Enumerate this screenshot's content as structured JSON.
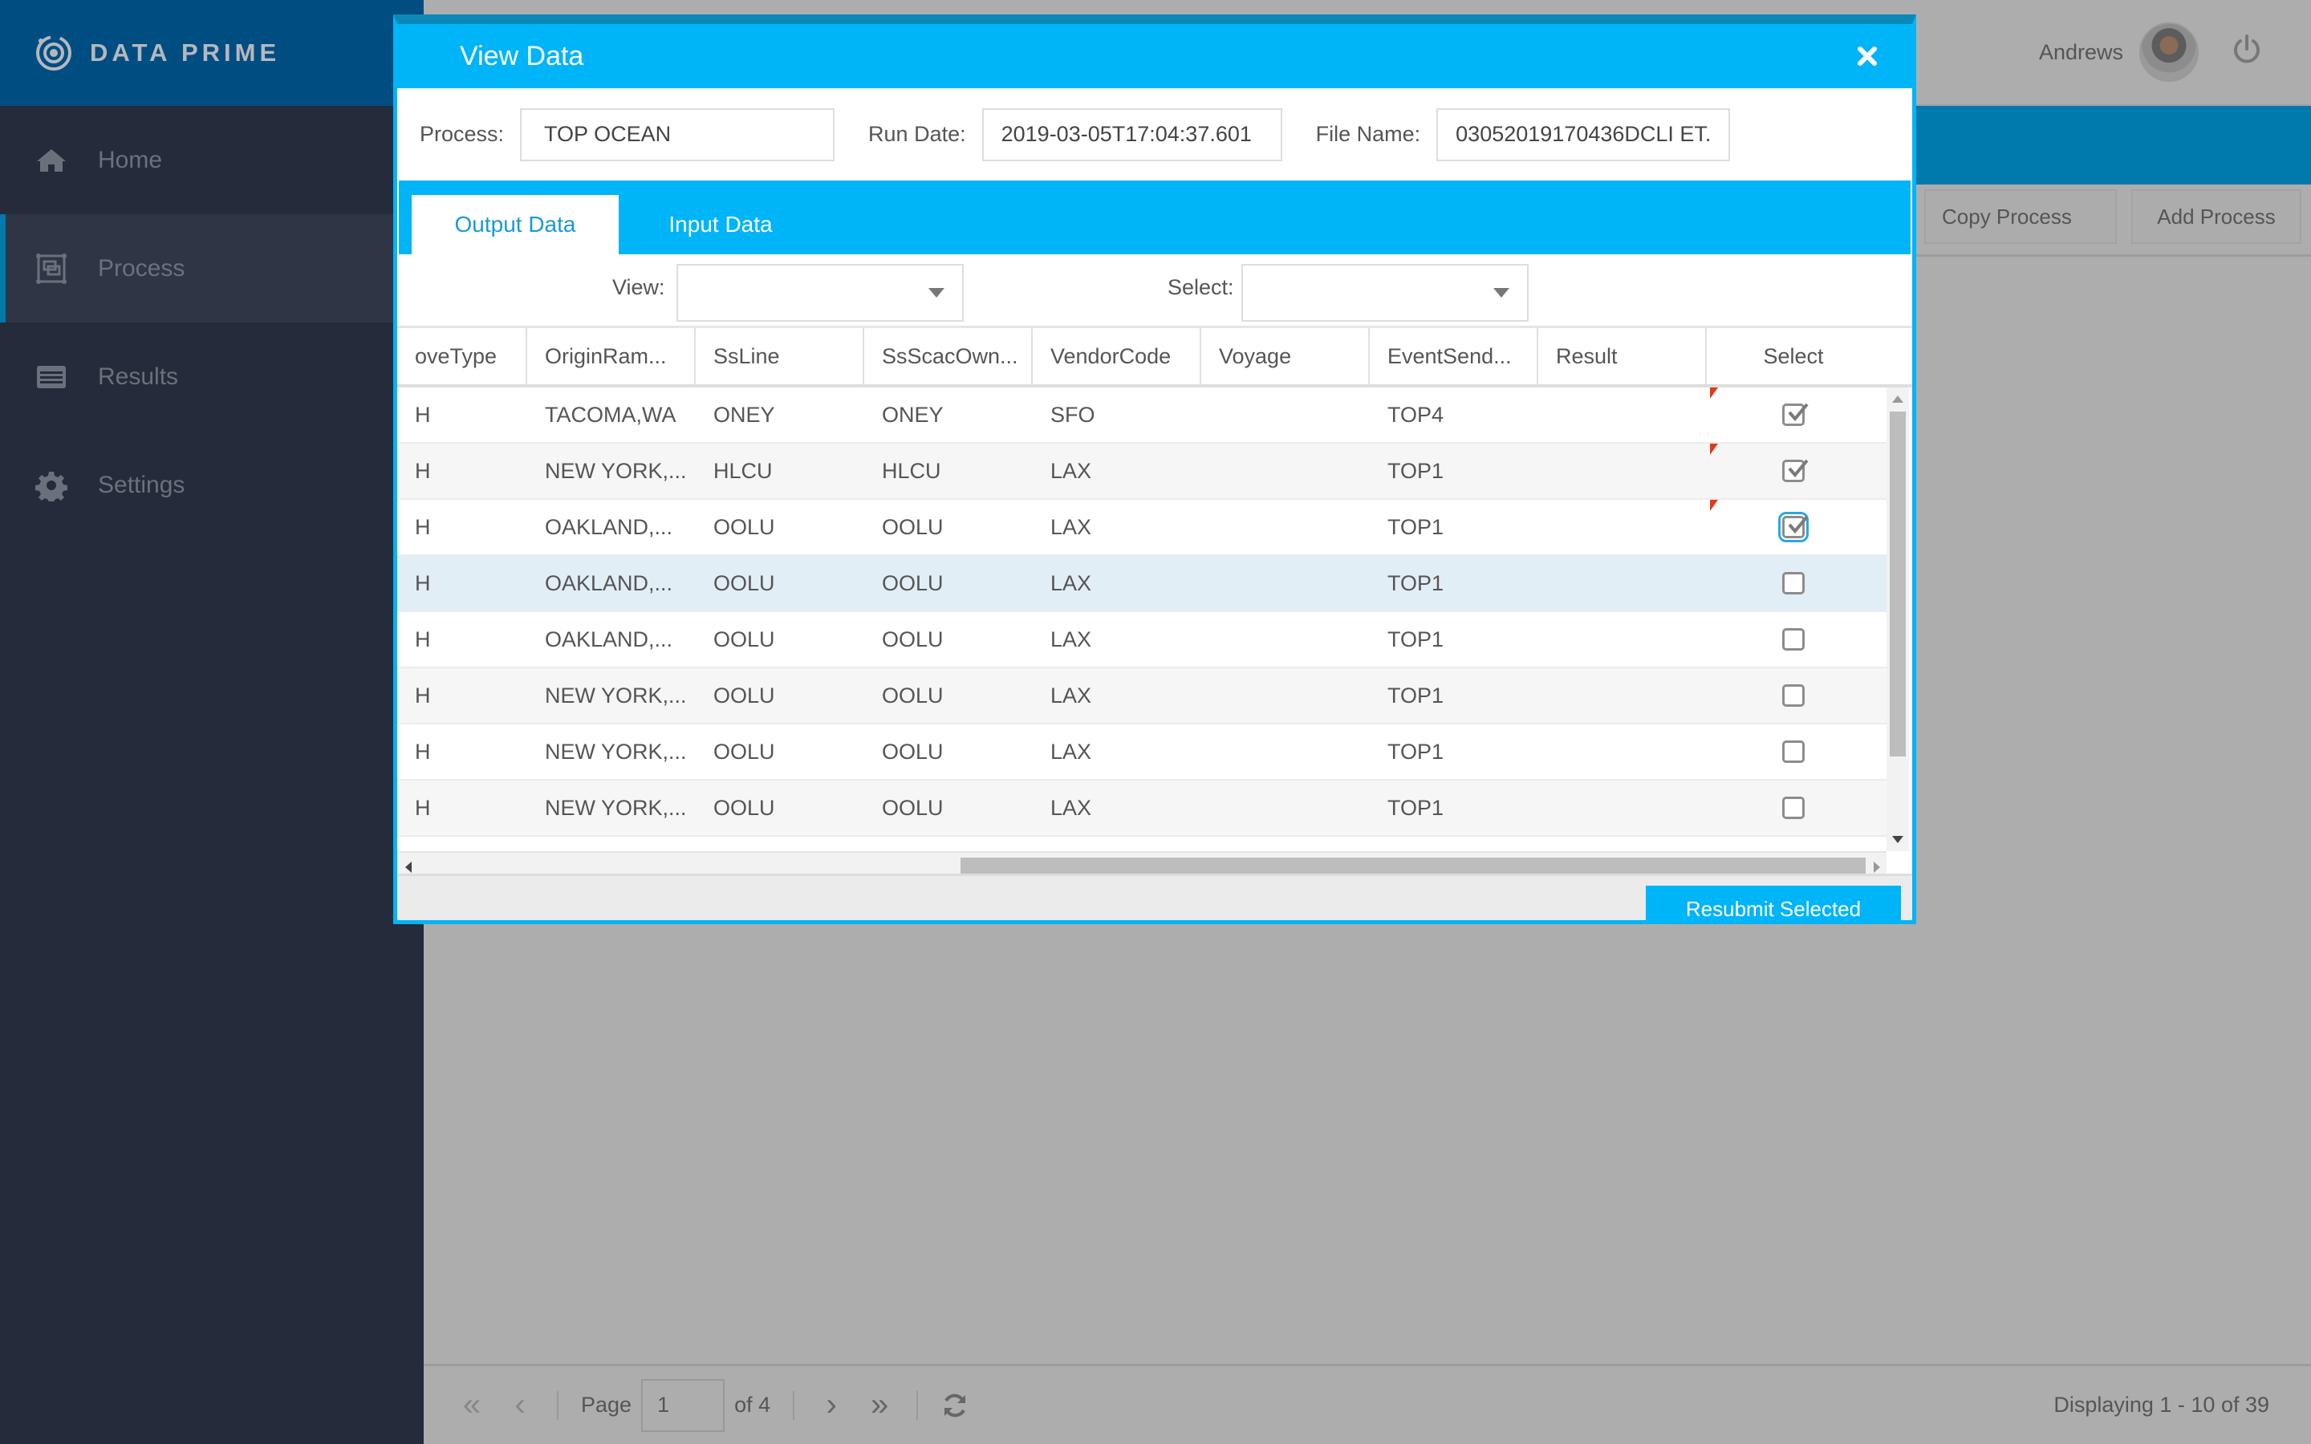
{
  "app": {
    "brand_name": "DATA PRIME",
    "user_name": "Andrews",
    "colors": {
      "accent": "#00b4f8",
      "brand_header": "#004d82",
      "sidebar_bg": "#242b3a",
      "band": "#0079ac",
      "flag": "#e03a1a"
    }
  },
  "sidebar": {
    "items": [
      {
        "label": "Home",
        "icon": "home-icon",
        "active": false
      },
      {
        "label": "Process",
        "icon": "process-icon",
        "active": true
      },
      {
        "label": "Results",
        "icon": "list-icon",
        "active": false
      },
      {
        "label": "Settings",
        "icon": "gear-icon",
        "active": false
      }
    ]
  },
  "toolbar": {
    "copy_label": "Copy Process",
    "add_label": "Add Process"
  },
  "pagination": {
    "page_label": "Page",
    "current_page": "1",
    "of_label": "of 4",
    "displaying": "Displaying 1 - 10 of 39"
  },
  "modal": {
    "title": "View Data",
    "fields": {
      "process_label": "Process:",
      "process_value": "TOP OCEAN",
      "run_date_label": "Run Date:",
      "run_date_value": "2019-03-05T17:04:37.601",
      "file_name_label": "File Name:",
      "file_name_value": "03052019170436DCLI ET."
    },
    "tabs": [
      {
        "label": "Output Data",
        "active": true
      },
      {
        "label": "Input Data",
        "active": false
      }
    ],
    "filters": {
      "view_label": "View:",
      "view_value": "",
      "select_label": "Select:",
      "select_value": ""
    },
    "grid": {
      "columns": [
        "oveType",
        "OriginRam...",
        "SsLine",
        "SsScacOwn...",
        "VendorCode",
        "Voyage",
        "EventSend...",
        "Result",
        "Select"
      ],
      "rows": [
        {
          "cells": [
            "H",
            "TACOMA,WA",
            "ONEY",
            "ONEY",
            "SFO",
            "",
            "TOP4",
            ""
          ],
          "selected": true,
          "dirty": true
        },
        {
          "cells": [
            "H",
            "NEW YORK,...",
            "HLCU",
            "HLCU",
            "LAX",
            "",
            "TOP1",
            ""
          ],
          "selected": true,
          "dirty": true
        },
        {
          "cells": [
            "H",
            "OAKLAND,...",
            "OOLU",
            "OOLU",
            "LAX",
            "",
            "TOP1",
            ""
          ],
          "selected": true,
          "dirty": true,
          "focused": true
        },
        {
          "cells": [
            "H",
            "OAKLAND,...",
            "OOLU",
            "OOLU",
            "LAX",
            "",
            "TOP1",
            ""
          ],
          "selected": false,
          "highlighted": true
        },
        {
          "cells": [
            "H",
            "OAKLAND,...",
            "OOLU",
            "OOLU",
            "LAX",
            "",
            "TOP1",
            ""
          ],
          "selected": false
        },
        {
          "cells": [
            "H",
            "NEW YORK,...",
            "OOLU",
            "OOLU",
            "LAX",
            "",
            "TOP1",
            ""
          ],
          "selected": false
        },
        {
          "cells": [
            "H",
            "NEW YORK,...",
            "OOLU",
            "OOLU",
            "LAX",
            "",
            "TOP1",
            ""
          ],
          "selected": false
        },
        {
          "cells": [
            "H",
            "NEW YORK,...",
            "OOLU",
            "OOLU",
            "LAX",
            "",
            "TOP1",
            ""
          ],
          "selected": false
        }
      ]
    },
    "resubmit_label": "Resubmit Selected"
  }
}
